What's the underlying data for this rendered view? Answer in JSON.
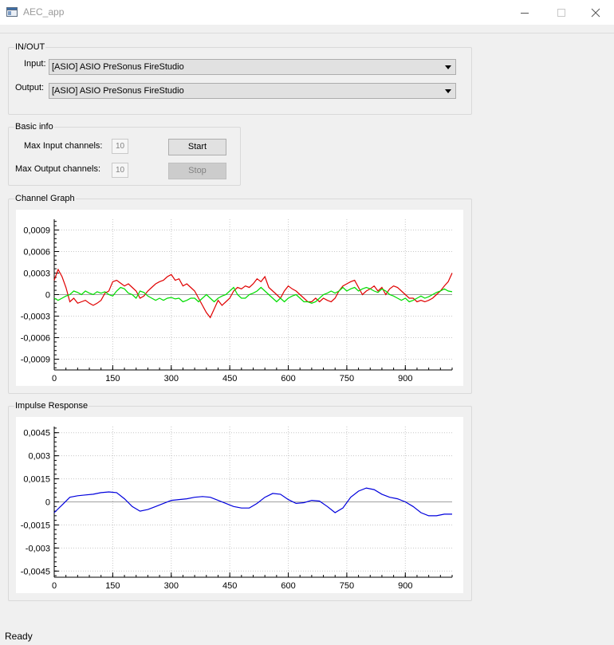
{
  "window": {
    "title": "AEC_app"
  },
  "inout": {
    "title": "IN/OUT",
    "input_label": "Input:",
    "input_value": "[ASIO] ASIO PreSonus FireStudio",
    "output_label": "Output:",
    "output_value": "[ASIO] ASIO PreSonus FireStudio"
  },
  "basic": {
    "title": "Basic info",
    "max_input_label": "Max Input channels:",
    "max_input_value": "10",
    "max_output_label": "Max Output channels:",
    "max_output_value": "10",
    "start_label": "Start",
    "stop_label": "Stop"
  },
  "status": {
    "text": "Ready"
  },
  "colors": {
    "accent_red": "#e00000",
    "accent_green": "#00dd00",
    "accent_blue": "#0000dd"
  },
  "chart_data": [
    {
      "type": "line",
      "title": "Channel Graph",
      "xlim": [
        0,
        1020
      ],
      "ylim": [
        -0.00105,
        0.00105
      ],
      "xticks": [
        0,
        150,
        300,
        450,
        600,
        750,
        900
      ],
      "xtick_labels": [
        "0",
        "150",
        "300",
        "450",
        "600",
        "750",
        "900"
      ],
      "yticks": [
        0.0009,
        0.0006,
        0.0003,
        0,
        -0.0003,
        -0.0006,
        -0.0009
      ],
      "ytick_labels": [
        "0,0009",
        "0,0006",
        "0,0003",
        "0",
        "-0,0003",
        "-0,0006",
        "-0,0009"
      ],
      "grid": true,
      "series": [
        {
          "color": "#e00000",
          "x": [
            0,
            10,
            20,
            30,
            40,
            50,
            60,
            70,
            80,
            90,
            100,
            110,
            120,
            130,
            140,
            150,
            160,
            170,
            180,
            190,
            200,
            210,
            220,
            230,
            240,
            250,
            260,
            270,
            280,
            290,
            300,
            310,
            320,
            330,
            340,
            350,
            360,
            370,
            380,
            390,
            400,
            410,
            420,
            430,
            440,
            450,
            460,
            470,
            480,
            490,
            500,
            510,
            520,
            530,
            540,
            550,
            560,
            570,
            580,
            590,
            600,
            610,
            620,
            630,
            640,
            650,
            660,
            670,
            680,
            690,
            700,
            710,
            720,
            730,
            740,
            750,
            760,
            770,
            780,
            790,
            800,
            810,
            820,
            830,
            840,
            850,
            860,
            870,
            880,
            890,
            900,
            910,
            920,
            930,
            940,
            950,
            960,
            970,
            980,
            990,
            1000,
            1010,
            1020
          ],
          "values": [
            0.0002,
            0.00035,
            0.00025,
            0.0001,
            -0.0001,
            -5e-05,
            -0.00012,
            -0.0001,
            -8e-05,
            -0.00012,
            -0.00015,
            -0.00012,
            -8e-05,
            2e-05,
            5e-05,
            0.00018,
            0.0002,
            0.00016,
            0.00012,
            0.00015,
            0.0001,
            5e-05,
            -5e-05,
            -2e-05,
            5e-05,
            0.0001,
            0.00015,
            0.00018,
            0.0002,
            0.00025,
            0.00028,
            0.0002,
            0.00022,
            0.00012,
            0.00015,
            0.0001,
            5e-05,
            -5e-05,
            -0.00015,
            -0.00025,
            -0.00032,
            -0.0002,
            -8e-05,
            -0.00015,
            -0.0001,
            -5e-05,
            5e-05,
            0.0001,
            8e-05,
            0.00012,
            0.0001,
            0.00015,
            0.00022,
            0.00018,
            0.00025,
            0.0001,
            5e-05,
            0.0,
            -5e-05,
            5e-05,
            0.00012,
            8e-05,
            5e-05,
            0.0,
            -5e-05,
            -0.0001,
            -0.0001,
            -5e-05,
            -0.0001,
            -5e-05,
            -8e-05,
            -0.0001,
            -5e-05,
            5e-05,
            0.00012,
            0.00015,
            0.00018,
            0.0002,
            0.0001,
            0.0,
            5e-05,
            8e-05,
            0.00012,
            5e-05,
            0.0001,
            0.0,
            8e-05,
            0.00012,
            0.0001,
            5e-05,
            -0.0,
            -5e-05,
            -5e-05,
            -0.0001,
            -8e-05,
            -0.0001,
            -8e-05,
            -5e-05,
            0.0,
            5e-05,
            0.00012,
            0.00018,
            0.0003
          ]
        },
        {
          "color": "#00dd00",
          "x": [
            0,
            10,
            20,
            30,
            40,
            50,
            60,
            70,
            80,
            90,
            100,
            110,
            120,
            130,
            140,
            150,
            160,
            170,
            180,
            190,
            200,
            210,
            220,
            230,
            240,
            250,
            260,
            270,
            280,
            290,
            300,
            310,
            320,
            330,
            340,
            350,
            360,
            370,
            380,
            390,
            400,
            410,
            420,
            430,
            440,
            450,
            460,
            470,
            480,
            490,
            500,
            510,
            520,
            530,
            540,
            550,
            560,
            570,
            580,
            590,
            600,
            610,
            620,
            630,
            640,
            650,
            660,
            670,
            680,
            690,
            700,
            710,
            720,
            730,
            740,
            750,
            760,
            770,
            780,
            790,
            800,
            810,
            820,
            830,
            840,
            850,
            860,
            870,
            880,
            890,
            900,
            910,
            920,
            930,
            940,
            950,
            960,
            970,
            980,
            990,
            1000,
            1010,
            1020
          ],
          "values": [
            -5e-05,
            -8e-05,
            -5e-05,
            -2e-05,
            0.0,
            5e-05,
            3e-05,
            0.0,
            5e-05,
            2e-05,
            0.0,
            4e-05,
            2e-05,
            4e-05,
            0.0,
            -2e-05,
            5e-05,
            0.0001,
            8e-05,
            2e-05,
            0.0,
            -5e-05,
            5e-05,
            3e-05,
            -2e-05,
            -5e-05,
            -8e-05,
            -5e-05,
            -8e-05,
            -5e-05,
            -4e-05,
            -6e-05,
            -5e-05,
            -0.0001,
            -8e-05,
            -5e-05,
            -5e-05,
            -0.0001,
            -5e-05,
            0.0,
            -5e-05,
            -0.0001,
            -5e-05,
            -2e-05,
            0.0,
            5e-05,
            0.0001,
            0.0,
            -5e-05,
            -5e-05,
            0.0,
            2e-05,
            5e-05,
            0.0001,
            5e-05,
            0.0,
            -5e-05,
            -0.0001,
            -5e-05,
            -0.0001,
            -5e-05,
            -2e-05,
            0.0,
            -5e-05,
            -0.0001,
            -0.0001,
            -0.00012,
            -0.0001,
            -5e-05,
            0.0,
            2e-05,
            5e-05,
            2e-05,
            5e-05,
            0.0001,
            5e-05,
            8e-05,
            0.0001,
            5e-05,
            8e-05,
            0.0001,
            8e-05,
            5e-05,
            3e-05,
            8e-05,
            5e-05,
            0.0,
            -2e-05,
            -5e-05,
            -8e-05,
            -5e-05,
            -0.0001,
            -8e-05,
            -5e-05,
            -2e-05,
            -5e-05,
            -3e-05,
            0.0,
            3e-05,
            5e-05,
            8e-05,
            5e-05,
            4e-05
          ]
        }
      ]
    },
    {
      "type": "line",
      "title": "Impulse Response",
      "xlim": [
        0,
        1020
      ],
      "ylim": [
        -0.0049,
        0.0049
      ],
      "xticks": [
        0,
        150,
        300,
        450,
        600,
        750,
        900
      ],
      "xtick_labels": [
        "0",
        "150",
        "300",
        "450",
        "600",
        "750",
        "900"
      ],
      "yticks": [
        0.0045,
        0.003,
        0.0015,
        0,
        -0.0015,
        -0.003,
        -0.0045
      ],
      "ytick_labels": [
        "0,0045",
        "0,003",
        "0,0015",
        "0",
        "-0,0015",
        "-0,003",
        "-0,0045"
      ],
      "grid": true,
      "series": [
        {
          "color": "#0000dd",
          "x": [
            0,
            20,
            40,
            60,
            80,
            100,
            120,
            140,
            160,
            180,
            200,
            220,
            240,
            260,
            280,
            300,
            320,
            340,
            360,
            380,
            400,
            420,
            440,
            460,
            480,
            500,
            520,
            540,
            560,
            580,
            600,
            620,
            640,
            660,
            680,
            700,
            720,
            740,
            760,
            780,
            800,
            820,
            840,
            860,
            880,
            900,
            920,
            940,
            960,
            980,
            1000,
            1020
          ],
          "values": [
            -0.0007,
            -0.0002,
            0.0003,
            0.0004,
            0.00045,
            0.0005,
            0.0006,
            0.00065,
            0.0006,
            0.0002,
            -0.0003,
            -0.0006,
            -0.0005,
            -0.0003,
            -0.0001,
            0.0001,
            0.00015,
            0.0002,
            0.0003,
            0.00035,
            0.0003,
            0.0001,
            -0.0001,
            -0.0003,
            -0.0004,
            -0.0004,
            -0.0001,
            0.0003,
            0.00055,
            0.0005,
            0.00015,
            -0.0001,
            -5e-05,
            0.0001,
            5e-05,
            -0.0003,
            -0.0007,
            -0.0004,
            0.0003,
            0.0007,
            0.0009,
            0.0008,
            0.0005,
            0.0003,
            0.0002,
            0.0,
            -0.0003,
            -0.0007,
            -0.0009,
            -0.0009,
            -0.0008,
            -0.0008
          ]
        }
      ]
    }
  ]
}
